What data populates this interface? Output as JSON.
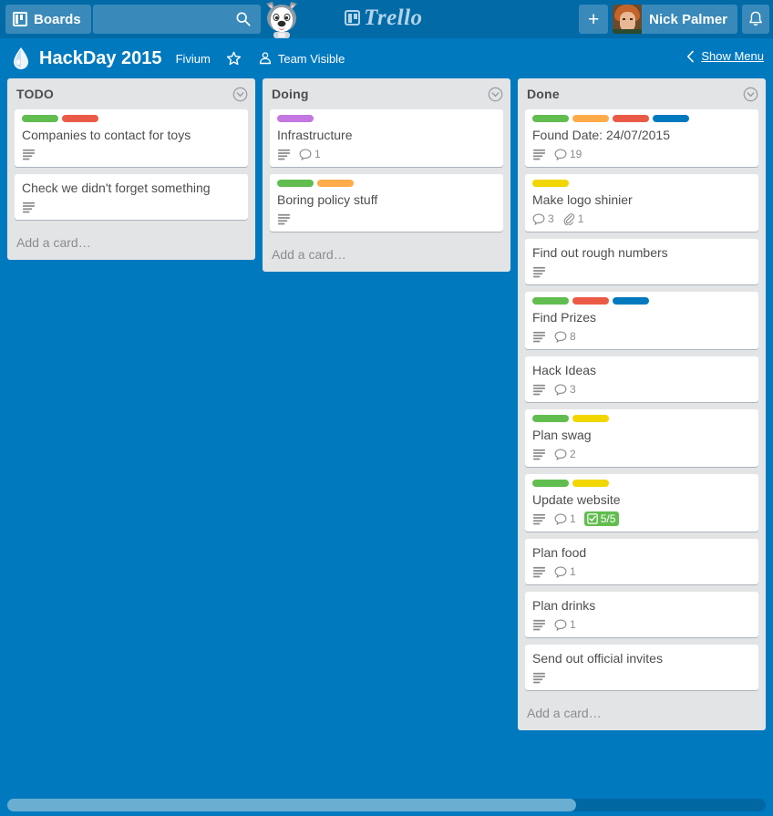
{
  "colors": {
    "brand_blue": "#0079bf",
    "header_blue": "#026aa7",
    "list_grey": "#e2e4e6",
    "card_white": "#ffffff",
    "text_grey": "#4d4d4d",
    "label_green": "#61bd4f",
    "label_yellow": "#f2d600",
    "label_orange": "#ffab4a",
    "label_red": "#eb5a46",
    "label_blue": "#0079bf",
    "label_purple": "#c377e0"
  },
  "topbar": {
    "boards_label": "Boards",
    "boards_icon": "board-icon",
    "search_placeholder": "",
    "search_value": "",
    "search_icon": "search-icon",
    "mascot_icon": "taco-husky-icon",
    "logo_text": "Trello",
    "logo_icon": "trello-board-icon",
    "add_label": "+",
    "add_icon": "plus-icon",
    "member_name": "Nick Palmer",
    "avatar_icon": "avatar",
    "notifications_icon": "bell-icon"
  },
  "board_header": {
    "drop_icon": "water-drop-icon",
    "title": "HackDay 2015",
    "organization": "Fivium",
    "star_icon": "star-icon",
    "visibility_icon": "team-visibility-icon",
    "visibility_label": "Team Visible",
    "show_menu_label": "Show Menu",
    "chevron_icon": "chevron-left-icon"
  },
  "lists": [
    {
      "id": "todo",
      "title": "TODO",
      "menu_icon": "list-menu-icon",
      "add_card_label": "Add a card…",
      "cards": [
        {
          "title": "Companies to contact for toys",
          "labels": [
            "#61bd4f",
            "#eb5a46"
          ],
          "description": true,
          "comments": null,
          "attachments": null,
          "checklist": null
        },
        {
          "title": "Check we didn't forget something",
          "labels": [],
          "description": true,
          "comments": null,
          "attachments": null,
          "checklist": null
        }
      ]
    },
    {
      "id": "doing",
      "title": "Doing",
      "menu_icon": "list-menu-icon",
      "add_card_label": "Add a card…",
      "cards": [
        {
          "title": "Infrastructure",
          "labels": [
            "#c377e0"
          ],
          "description": true,
          "comments": "1",
          "attachments": null,
          "checklist": null
        },
        {
          "title": "Boring policy stuff",
          "labels": [
            "#61bd4f",
            "#ffab4a"
          ],
          "description": true,
          "comments": null,
          "attachments": null,
          "checklist": null
        }
      ]
    },
    {
      "id": "done",
      "title": "Done",
      "menu_icon": "list-menu-icon",
      "add_card_label": "Add a card…",
      "cards": [
        {
          "title": "Found Date: 24/07/2015",
          "labels": [
            "#61bd4f",
            "#ffab4a",
            "#eb5a46",
            "#0079bf"
          ],
          "description": true,
          "comments": "19",
          "attachments": null,
          "checklist": null
        },
        {
          "title": "Make logo shinier",
          "labels": [
            "#f2d600"
          ],
          "description": false,
          "comments": "3",
          "attachments": "1",
          "checklist": null
        },
        {
          "title": "Find out rough numbers",
          "labels": [],
          "description": true,
          "comments": null,
          "attachments": null,
          "checklist": null
        },
        {
          "title": "Find Prizes",
          "labels": [
            "#61bd4f",
            "#eb5a46",
            "#0079bf"
          ],
          "description": true,
          "comments": "8",
          "attachments": null,
          "checklist": null
        },
        {
          "title": "Hack Ideas",
          "labels": [],
          "description": true,
          "comments": "3",
          "attachments": null,
          "checklist": null
        },
        {
          "title": "Plan swag",
          "labels": [
            "#61bd4f",
            "#f2d600"
          ],
          "description": true,
          "comments": "2",
          "attachments": null,
          "checklist": null
        },
        {
          "title": "Update website",
          "labels": [
            "#61bd4f",
            "#f2d600"
          ],
          "description": true,
          "comments": "1",
          "attachments": null,
          "checklist": "5/5"
        },
        {
          "title": "Plan food",
          "labels": [],
          "description": true,
          "comments": "1",
          "attachments": null,
          "checklist": null
        },
        {
          "title": "Plan drinks",
          "labels": [],
          "description": true,
          "comments": "1",
          "attachments": null,
          "checklist": null
        },
        {
          "title": "Send out official invites",
          "labels": [],
          "description": true,
          "comments": null,
          "attachments": null,
          "checklist": null
        }
      ]
    }
  ],
  "scrollbar": {
    "orientation": "horizontal",
    "thumb_fraction": 0.75
  }
}
